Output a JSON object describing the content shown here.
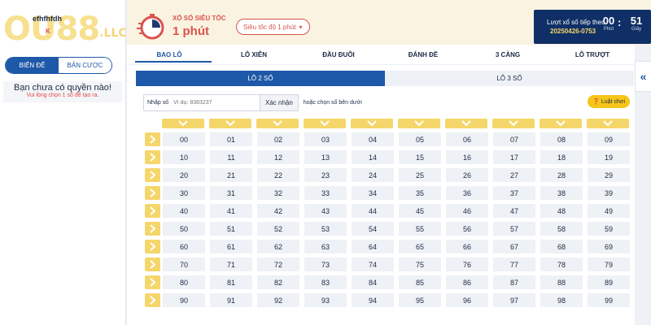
{
  "sidebar": {
    "logo": {
      "main": "OU88",
      "suffix": ".LLC"
    },
    "username": "efhfhfdh",
    "balance": "K",
    "tabs": [
      {
        "label": "BIẾN ĐỂ"
      },
      {
        "label": "BẢN CƯỢC"
      }
    ],
    "no_permission": "Bạn chưa có quyền nào!",
    "no_permission_hint": "Vui lòng chọn 1 số để tạo ra."
  },
  "header": {
    "subtitle": "XỔ SỐ SIÊU TỐC",
    "title": "1 phút",
    "speed_select": "Siêu tốc độ 1 phút",
    "next_draw_label": "Lượt xổ số tiếp theo",
    "draw_id": "20250426-0753",
    "minutes": "00",
    "minutes_unit": "Phút",
    "seconds": "51",
    "seconds_unit": "Giây",
    "colors": {
      "accent": "#d9534f",
      "dark": "#0f2f66"
    }
  },
  "nav": {
    "items": [
      {
        "label": "BAO LÔ"
      },
      {
        "label": "LÔ XIÊN"
      },
      {
        "label": "ĐẦU ĐUÔI"
      },
      {
        "label": "ĐÁNH ĐỀ"
      },
      {
        "label": "3 CÀNG"
      },
      {
        "label": "LÔ TRƯỢT"
      }
    ]
  },
  "main": {
    "subtabs": [
      {
        "label": "LÔ 2 SỐ"
      },
      {
        "label": "LÔ 3 SỐ"
      }
    ],
    "input_label": "Nhập số",
    "input_placeholder": "Ví dụ: 8383237",
    "confirm_label": "Xác nhận",
    "hint": "hoặc chọn số bên dưới",
    "rules_label": "Luật chơi",
    "grid": [
      [
        "00",
        "01",
        "02",
        "03",
        "04",
        "05",
        "06",
        "07",
        "08",
        "09"
      ],
      [
        "10",
        "11",
        "12",
        "13",
        "14",
        "15",
        "16",
        "17",
        "18",
        "19"
      ],
      [
        "20",
        "21",
        "22",
        "23",
        "24",
        "25",
        "26",
        "27",
        "28",
        "29"
      ],
      [
        "30",
        "31",
        "32",
        "33",
        "34",
        "35",
        "36",
        "37",
        "38",
        "39"
      ],
      [
        "40",
        "41",
        "42",
        "43",
        "44",
        "45",
        "46",
        "47",
        "48",
        "49"
      ],
      [
        "50",
        "51",
        "52",
        "53",
        "54",
        "55",
        "56",
        "57",
        "58",
        "59"
      ],
      [
        "60",
        "61",
        "62",
        "63",
        "64",
        "65",
        "66",
        "67",
        "68",
        "69"
      ],
      [
        "70",
        "71",
        "72",
        "73",
        "74",
        "75",
        "76",
        "77",
        "78",
        "79"
      ],
      [
        "80",
        "81",
        "82",
        "83",
        "84",
        "85",
        "86",
        "87",
        "88",
        "89"
      ],
      [
        "90",
        "91",
        "92",
        "93",
        "94",
        "95",
        "96",
        "97",
        "98",
        "99"
      ]
    ]
  }
}
